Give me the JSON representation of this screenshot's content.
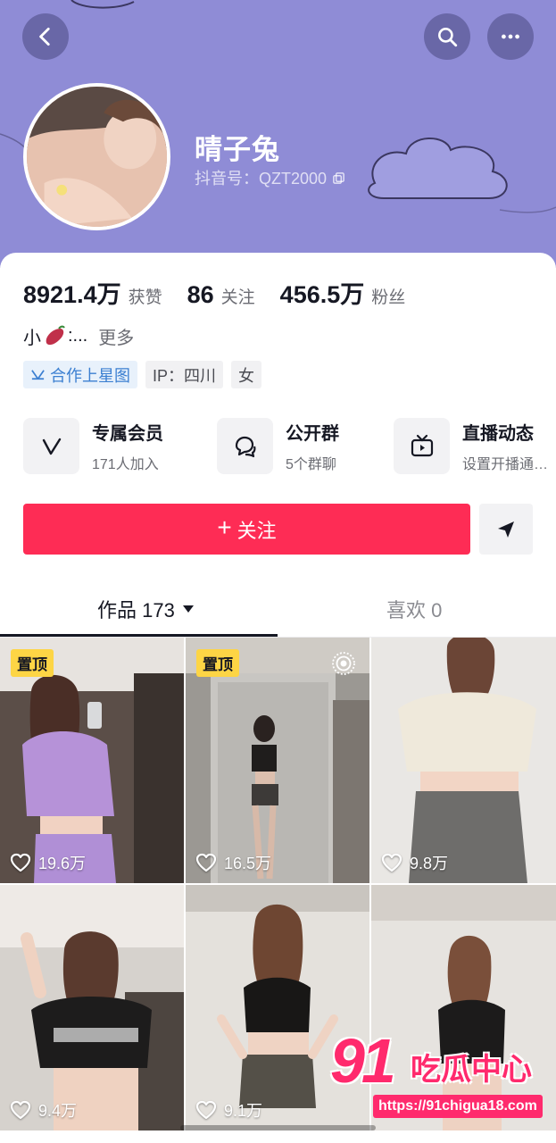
{
  "header": {
    "bg_color": "#8f8cd6",
    "back_icon": "chevron-left-icon",
    "search_icon": "search-icon",
    "more_icon": "more-horizontal-icon"
  },
  "profile": {
    "name": "晴子兔",
    "douyin_id": "抖音号：QZT2000",
    "avatar_icon": "avatar-photo"
  },
  "stats": [
    {
      "value": "8921.4万",
      "label": "获赞"
    },
    {
      "value": "86",
      "label": "关注"
    },
    {
      "value": "456.5万",
      "label": "粉丝"
    }
  ],
  "bio": {
    "prefix": "小",
    "suffix": ":...",
    "more": "更多"
  },
  "tags": [
    {
      "label": "合作上星图",
      "icon": "star-map-icon"
    },
    {
      "label": "IP：四川"
    },
    {
      "label": "女"
    }
  ],
  "features": [
    {
      "title": "专属会员",
      "subtitle": "171人加入",
      "icon": "vip-v-icon"
    },
    {
      "title": "公开群",
      "subtitle": "5个群聊",
      "icon": "group-chat-icon"
    },
    {
      "title": "直播动态",
      "subtitle": "设置开播通…",
      "icon": "tv-live-icon"
    }
  ],
  "actions": {
    "follow_plus": "+",
    "follow_label": "关注",
    "follow_color": "#fe2c55",
    "dm_icon": "send-message-icon"
  },
  "tabs": {
    "works": "作品 173",
    "likes": "喜欢 0"
  },
  "videos": [
    {
      "pinned": "置顶",
      "likes": "19.6万"
    },
    {
      "pinned": "置顶",
      "likes": "16.5万",
      "live": true
    },
    {
      "likes": "9.8万"
    },
    {
      "likes": "9.4万"
    },
    {
      "likes": "9.1万"
    },
    {
      "likes": ""
    }
  ],
  "watermark": {
    "logo": "91",
    "name": "吃瓜中心",
    "url": "https://91chigua18.com"
  }
}
